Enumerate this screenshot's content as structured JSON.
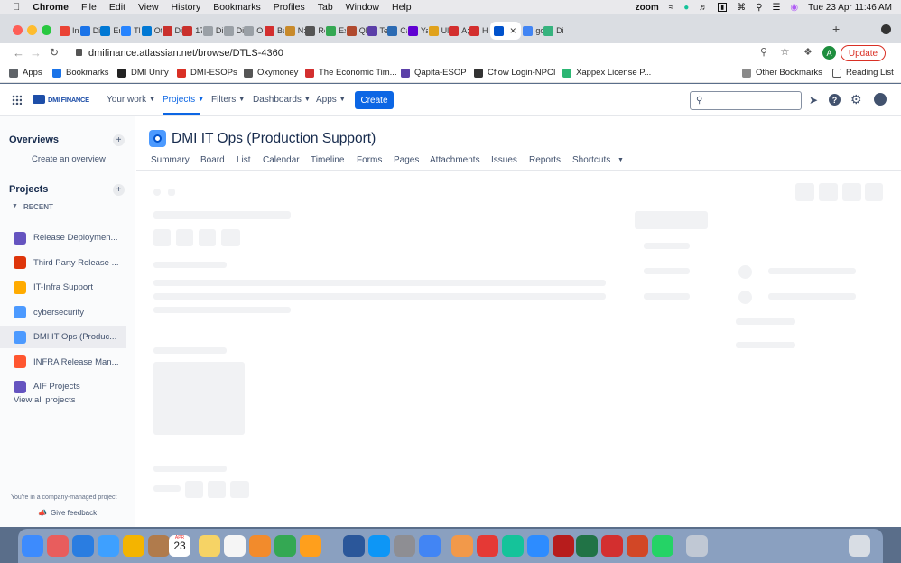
{
  "menubar": {
    "app": "Chrome",
    "items": [
      "File",
      "Edit",
      "View",
      "History",
      "Bookmarks",
      "Profiles",
      "Tab",
      "Window",
      "Help"
    ],
    "zoom_label": "zoom",
    "datetime": "Tue 23 Apr  11:46 AM"
  },
  "tabs": [
    {
      "label": "In",
      "color": "#ea4335"
    },
    {
      "label": "Di",
      "color": "#1a73e8"
    },
    {
      "label": "Er",
      "color": "#0078d4"
    },
    {
      "label": "Tl",
      "color": "#2684ff"
    },
    {
      "label": "Ot",
      "color": "#0078d4"
    },
    {
      "label": "Di",
      "color": "#c9302c"
    },
    {
      "label": "17",
      "color": "#c9302c"
    },
    {
      "label": "Di",
      "color": "#9aa0a6"
    },
    {
      "label": "Di",
      "color": "#9aa0a6"
    },
    {
      "label": "O:",
      "color": "#9aa0a6"
    },
    {
      "label": "Bu",
      "color": "#d32f2f"
    },
    {
      "label": "N:",
      "color": "#c88a2b"
    },
    {
      "label": "Rc",
      "color": "#555555"
    },
    {
      "label": "Ex",
      "color": "#34a853"
    },
    {
      "label": "Ql",
      "color": "#b04a2f"
    },
    {
      "label": "Te",
      "color": "#5b3fa8"
    },
    {
      "label": "Ca",
      "color": "#2c6bb3"
    },
    {
      "label": "Ya",
      "color": "#6001d2"
    },
    {
      "label": "Ul",
      "color": "#e0a21c"
    },
    {
      "label": "A;",
      "color": "#d32f2f"
    },
    {
      "label": "H",
      "color": "#d32f2f"
    },
    {
      "label": "",
      "color": "#0052cc"
    },
    {
      "label": "gc",
      "color": "#4285f4"
    },
    {
      "label": "Di",
      "color": "#36b37e"
    }
  ],
  "address": {
    "url": "dmifinance.atlassian.net/browse/DTLS-4360",
    "avatar_letter": "A",
    "update_label": "Update"
  },
  "bookmarks": {
    "items": [
      {
        "label": "Apps",
        "color": "#5f6368"
      },
      {
        "label": "Bookmarks",
        "color": "#1a73e8"
      },
      {
        "label": "DMI Unify",
        "color": "#222222"
      },
      {
        "label": "DMI-ESOPs",
        "color": "#d93025"
      },
      {
        "label": "Oxymoney",
        "color": "#555555"
      },
      {
        "label": "The Economic Tim...",
        "color": "#d32f2f"
      },
      {
        "label": "Qapita-ESOP",
        "color": "#5b3fa8"
      },
      {
        "label": "Cflow Login-NPCI",
        "color": "#333333"
      },
      {
        "label": "Xappex License P...",
        "color": "#2bb673"
      }
    ],
    "other": "Other Bookmarks",
    "reading_list": "Reading List"
  },
  "jira": {
    "logo_text": "DMI FINANCE",
    "nav": [
      "Your work",
      "Projects",
      "Filters",
      "Dashboards",
      "Apps"
    ],
    "create_label": "Create"
  },
  "sidebar": {
    "overviews_title": "Overviews",
    "create_overview": "Create an overview",
    "projects_title": "Projects",
    "recent_label": "RECENT",
    "projects": [
      {
        "label": "Release Deploymen...",
        "color": "#6554c0"
      },
      {
        "label": "Third Party Release ...",
        "color": "#de350b"
      },
      {
        "label": "IT-Infra Support",
        "color": "#ffab00"
      },
      {
        "label": "cybersecurity",
        "color": "#4c9aff"
      },
      {
        "label": "DMI IT Ops (Produc...",
        "color": "#4c9aff"
      },
      {
        "label": "INFRA Release Man...",
        "color": "#ff5630"
      },
      {
        "label": "AIF Projects",
        "color": "#6554c0"
      }
    ],
    "view_all": "View all projects",
    "footer_note": "You're in a company-managed project",
    "feedback": "Give feedback"
  },
  "project": {
    "title": "DMI IT Ops (Production Support)",
    "tabs": [
      "Summary",
      "Board",
      "List",
      "Calendar",
      "Timeline",
      "Forms",
      "Pages",
      "Attachments",
      "Issues",
      "Reports",
      "Shortcuts"
    ]
  },
  "dock": {
    "calendar_month": "APR",
    "calendar_day": "23",
    "apps": [
      "finder",
      "launchpad",
      "safari",
      "mail",
      "photos",
      "contacts",
      "calendar",
      "notes",
      "reminders",
      "keynote",
      "numbers",
      "pages",
      "word",
      "appstore",
      "settings",
      "chrome",
      "vpn",
      "anydesk",
      "grammarly",
      "zoom",
      "filezilla",
      "excel",
      "acrobat",
      "powerpoint",
      "whatsapp",
      "files",
      "trash"
    ]
  }
}
